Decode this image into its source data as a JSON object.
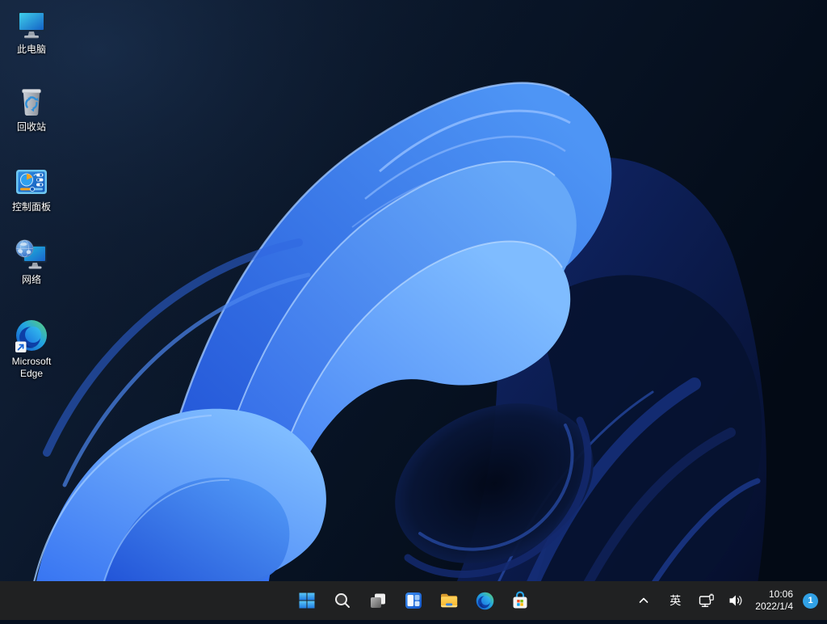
{
  "desktop": {
    "icons": [
      {
        "name": "this-pc",
        "label": "此电脑"
      },
      {
        "name": "recycle-bin",
        "label": "回收站"
      },
      {
        "name": "control-panel",
        "label": "控制面板"
      },
      {
        "name": "network",
        "label": "网络"
      },
      {
        "name": "microsoft-edge",
        "label": "Microsoft Edge"
      }
    ]
  },
  "taskbar": {
    "buttons": [
      {
        "icon": "windows-start-logo"
      },
      {
        "icon": "search"
      },
      {
        "icon": "task-view"
      },
      {
        "icon": "widgets"
      },
      {
        "icon": "file-explorer-folder"
      },
      {
        "icon": "microsoft-edge"
      },
      {
        "icon": "microsoft-store"
      }
    ],
    "tray": {
      "hidden_icons_chevron": "^",
      "ime": "英",
      "icons": [
        "network-ethernet",
        "volume"
      ],
      "time": "10:06",
      "date": "2022/1/4",
      "badge_count": "1"
    }
  },
  "colors": {
    "taskbar_bg": "#202122",
    "badge_blue": "#31a1e6",
    "start_logo_blue": "#3ba6f2",
    "wallpaper_bright_petal": "#3c7ff5",
    "wallpaper_dark_navy": "#0c1c4e",
    "wallpaper_background": "#081426"
  }
}
